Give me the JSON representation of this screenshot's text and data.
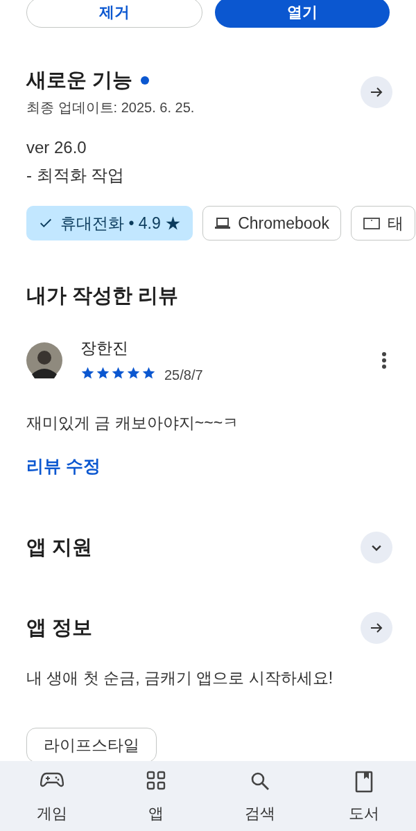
{
  "actions": [
    {
      "kind": "outline",
      "label": "제거"
    },
    {
      "kind": "filled",
      "label": "열기"
    }
  ],
  "whats_new": {
    "title": "새로운 기능",
    "new": true,
    "updated": "최종 업데이트: 2025. 6. 25.",
    "lines": [
      "ver 26.0",
      "- 최적화 작업"
    ]
  },
  "devices": [
    {
      "kind": "phone",
      "label": "휴대전화 • 4.9 ★",
      "selected": true
    },
    {
      "kind": "laptop",
      "label": "Chromebook",
      "selected": false
    },
    {
      "kind": "tablet",
      "label": "태",
      "selected": false
    }
  ],
  "my_review": {
    "title": "내가 작성한 리뷰",
    "author": "장한진",
    "stars": 5,
    "date": "25/8/7",
    "text": "재미있게 금 캐보아야지~~~ㅋ",
    "edit": "리뷰 수정"
  },
  "app_support": {
    "title": "앱 지원",
    "expanded": false
  },
  "app_info": {
    "title": "앱 정보",
    "description": "내 생애 첫 순금, 금캐기 앱으로 시작하세요!",
    "tags": [
      "라이프스타일"
    ]
  },
  "nav": [
    {
      "kind": "games",
      "label": "게임"
    },
    {
      "kind": "apps",
      "label": "앱"
    },
    {
      "kind": "search",
      "label": "검색"
    },
    {
      "kind": "books",
      "label": "도서"
    }
  ]
}
